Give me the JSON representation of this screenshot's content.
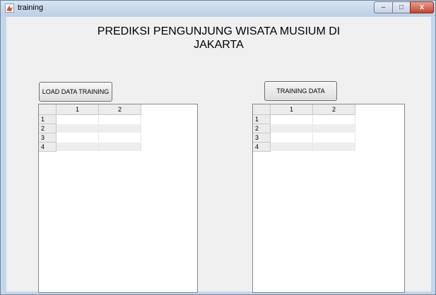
{
  "window": {
    "title": "training",
    "controls": {
      "minimize": "–",
      "maximize": "□",
      "close": "x"
    }
  },
  "heading": {
    "line1": "PREDIKSI PENGUNJUNG WISATA MUSIUM DI",
    "line2": "JAKARTA"
  },
  "buttons": {
    "load": "LOAD DATA TRAINING",
    "train": "TRAINING DATA"
  },
  "left_table": {
    "columns": [
      "1",
      "2"
    ],
    "rows": [
      "1",
      "2",
      "3",
      "4"
    ]
  },
  "right_table": {
    "columns": [
      "1",
      "2"
    ],
    "rows": [
      "1",
      "2",
      "3",
      "4"
    ]
  }
}
